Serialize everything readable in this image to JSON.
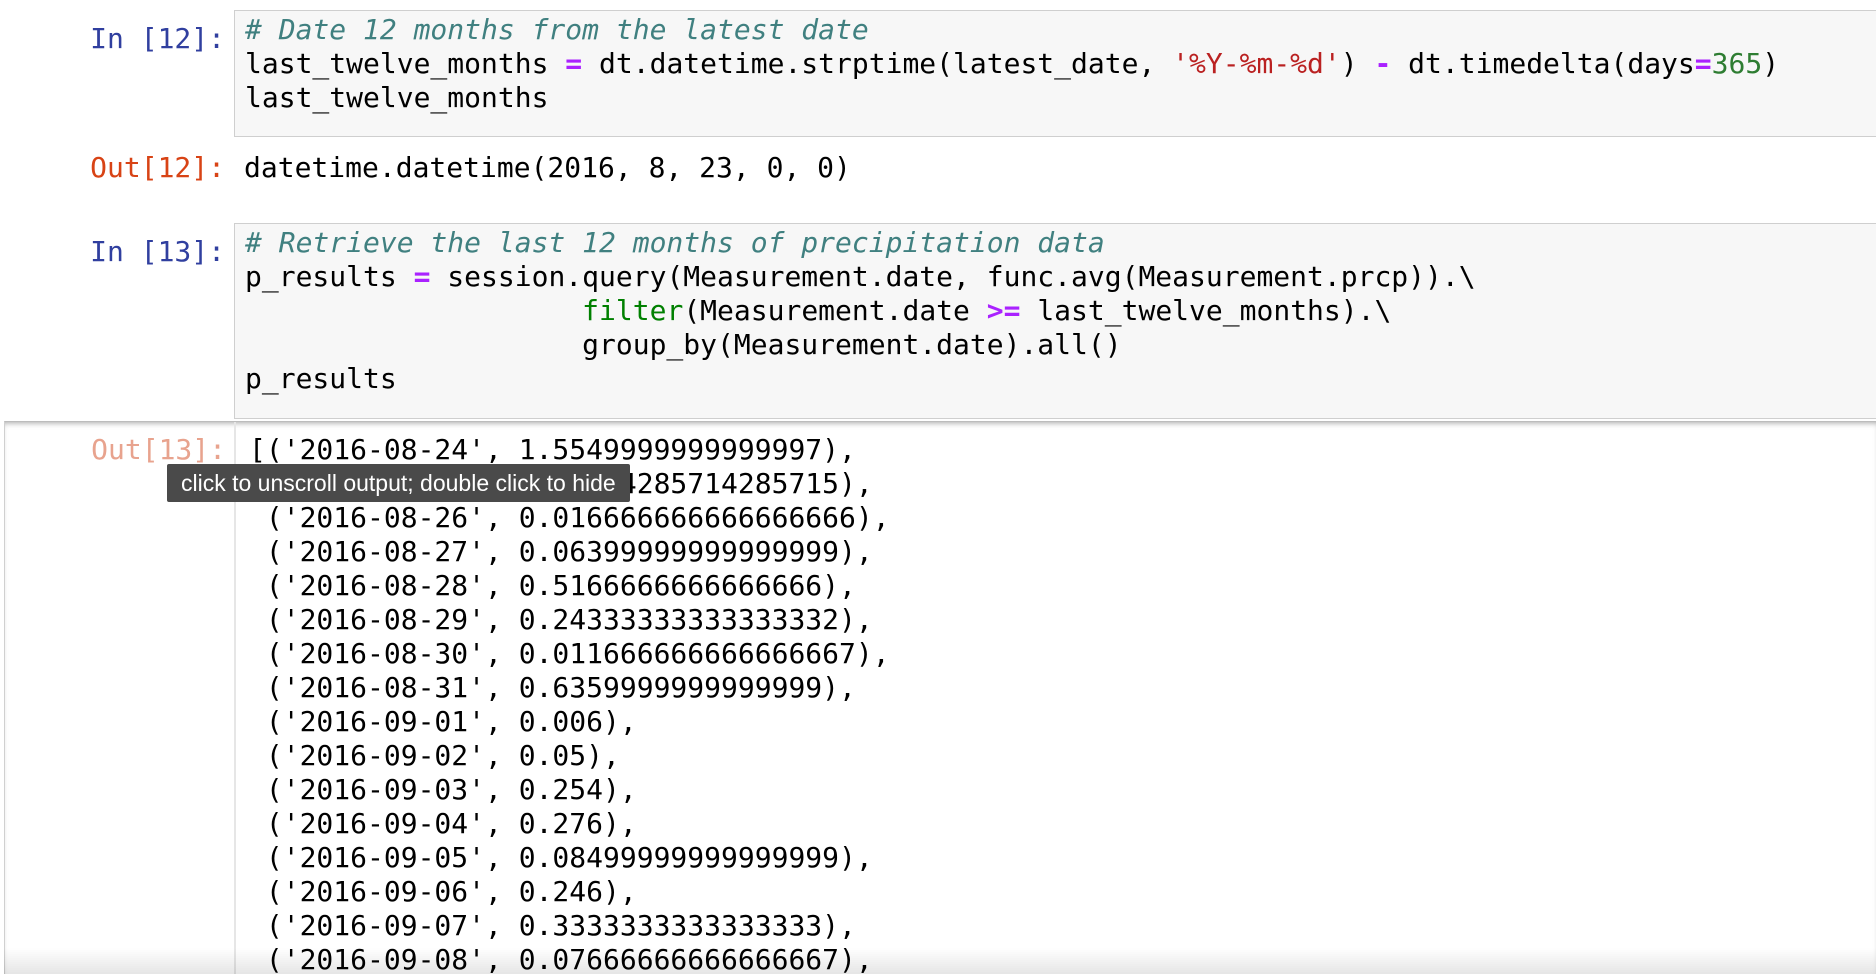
{
  "cells": [
    {
      "in_prompt": "In [12]:",
      "code_lines": [
        [
          {
            "t": "# Date 12 months from the latest date",
            "c": "cm-comment"
          }
        ],
        [
          {
            "t": "last_twelve_months ",
            "c": ""
          },
          {
            "t": "=",
            "c": "cm-op"
          },
          {
            "t": " dt.datetime.strptime(latest_date, ",
            "c": ""
          },
          {
            "t": "'%Y-%m-%d'",
            "c": "cm-str"
          },
          {
            "t": ") ",
            "c": ""
          },
          {
            "t": "-",
            "c": "cm-op"
          },
          {
            "t": " dt.timedelta(days",
            "c": ""
          },
          {
            "t": "=",
            "c": "cm-op"
          },
          {
            "t": "365",
            "c": "cm-num"
          },
          {
            "t": ")",
            "c": ""
          }
        ],
        [
          {
            "t": "last_twelve_months",
            "c": ""
          }
        ]
      ],
      "out_prompt": "Out[12]:",
      "output": "datetime.datetime(2016, 8, 23, 0, 0)"
    },
    {
      "in_prompt": "In [13]:",
      "code_lines": [
        [
          {
            "t": "# Retrieve the last 12 months of precipitation data",
            "c": "cm-comment"
          }
        ],
        [
          {
            "t": "p_results ",
            "c": ""
          },
          {
            "t": "=",
            "c": "cm-op"
          },
          {
            "t": " session.query(Measurement.date, func.avg(Measurement.prcp)).\\",
            "c": ""
          }
        ],
        [
          {
            "t": "                    ",
            "c": ""
          },
          {
            "t": "filter",
            "c": "cm-builtin"
          },
          {
            "t": "(Measurement.date ",
            "c": ""
          },
          {
            "t": ">=",
            "c": "cm-op"
          },
          {
            "t": " last_twelve_months).\\",
            "c": ""
          }
        ],
        [
          {
            "t": "                    group_by(Measurement.date).all()",
            "c": ""
          }
        ],
        [
          {
            "t": "p_results",
            "c": ""
          }
        ]
      ],
      "out_prompt": "Out[13]:",
      "output_lines": [
        "[('2016-08-24', 1.5549999999999997),",
        " ('2016-08-25', 0.07714285714285715),",
        " ('2016-08-26', 0.016666666666666666),",
        " ('2016-08-27', 0.06399999999999999),",
        " ('2016-08-28', 0.5166666666666666),",
        " ('2016-08-29', 0.24333333333333332),",
        " ('2016-08-30', 0.011666666666666667),",
        " ('2016-08-31', 0.6359999999999999),",
        " ('2016-09-01', 0.006),",
        " ('2016-09-02', 0.05),",
        " ('2016-09-03', 0.254),",
        " ('2016-09-04', 0.276),",
        " ('2016-09-05', 0.08499999999999999),",
        " ('2016-09-06', 0.246),",
        " ('2016-09-07', 0.3333333333333333),",
        " ('2016-09-08', 0.07666666666666667),"
      ]
    }
  ],
  "tooltip": "click to unscroll output; double click to hide",
  "colors": {
    "in_prompt": "#303f9f",
    "out_prompt": "#d84315",
    "comment": "#408080",
    "operator": "#aa22ff",
    "string": "#ba2121",
    "number": "#2e7d32",
    "builtin": "#008000"
  }
}
